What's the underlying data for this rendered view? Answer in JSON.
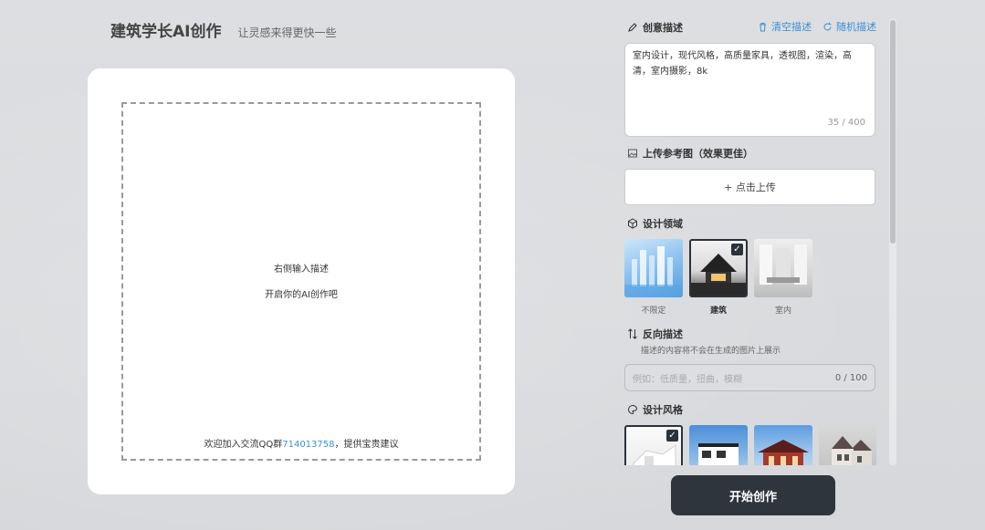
{
  "header": {
    "title": "建筑学长AI创作",
    "subtitle": "让灵感来得更快一些"
  },
  "canvas": {
    "hint_line1": "右侧输入描述",
    "hint_line2": "开启你的AI创作吧",
    "join_prefix": "欢迎加入交流QQ群",
    "join_qq": "714013758",
    "join_suffix": "，提供宝贵建议"
  },
  "panel": {
    "creative": {
      "label": "创意描述",
      "clear_label": "清空描述",
      "random_label": "随机描述",
      "text": "室内设计，现代风格，高质量家具，透视图，渲染，高清，室内摄影，8k",
      "count": "35 / 400"
    },
    "upload": {
      "label": "上传参考图（效果更佳）",
      "button_label": "+ 点击上传"
    },
    "domain": {
      "label": "设计领域",
      "options": [
        {
          "label": "不限定",
          "selected": false
        },
        {
          "label": "建筑",
          "selected": true
        },
        {
          "label": "室内",
          "selected": false
        }
      ]
    },
    "negative": {
      "label": "反向描述",
      "subtitle": "描述的内容将不会在生成的图片上展示",
      "placeholder": "例如：低质量，扭曲，模糊",
      "count": "0 / 100"
    },
    "style": {
      "label": "设计风格"
    }
  },
  "start_button": "开始创作",
  "colors": {
    "accent": "#3d8fd6",
    "dark": "#2e353d",
    "background": "#dadcdf"
  }
}
